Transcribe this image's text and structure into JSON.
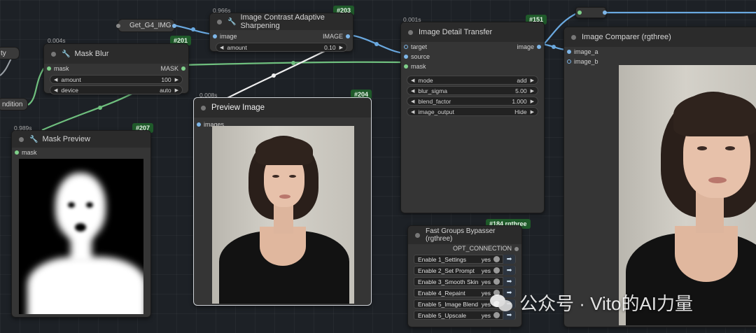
{
  "colors": {
    "badge_green": "#1f5a2a",
    "wire_blue": "#6aa9e0",
    "wire_green": "#6fbf7e",
    "wire_white": "#f0f0f0"
  },
  "left_fragments": {
    "top": "ty",
    "bottom": "ndition"
  },
  "get_node": {
    "label": "Get_G4_IMG"
  },
  "mask_blur": {
    "time": "0.004s",
    "badge": "#201",
    "title": "Mask Blur",
    "in_mask": "mask",
    "out_mask": "MASK",
    "amount_label": "amount",
    "amount_value": "100",
    "device_label": "device",
    "device_value": "auto"
  },
  "sharpen": {
    "time": "0.966s",
    "badge": "#203",
    "title": "Image Contrast Adaptive Sharpening",
    "in_image": "image",
    "out_image": "IMAGE",
    "amount_label": "amount",
    "amount_value": "0.10"
  },
  "detail": {
    "time": "0.001s",
    "badge": "#151",
    "title": "Image Detail Transfer",
    "in_target": "target",
    "in_source": "source",
    "in_mask": "mask",
    "out_image": "image",
    "widgets": [
      {
        "label": "mode",
        "value": "add"
      },
      {
        "label": "blur_sigma",
        "value": "5.00"
      },
      {
        "label": "blend_factor",
        "value": "1.000"
      },
      {
        "label": "image_output",
        "value": "Hide"
      }
    ]
  },
  "comparer": {
    "title": "Image Comparer (rgthree)",
    "in_a": "image_a",
    "in_b": "image_b"
  },
  "preview": {
    "time": "0.008s",
    "badge": "#204",
    "title": "Preview Image",
    "in_images": "images"
  },
  "mask_preview": {
    "time": "0.989s",
    "badge": "#207",
    "title": "Mask Preview",
    "in_mask": "mask"
  },
  "bypasser": {
    "badge": "#184 rgthree",
    "title": "Fast Groups Bypasser (rgthree)",
    "out": "OPT_CONNECTION",
    "items": [
      {
        "label": "Enable 1_Settings",
        "state": "yes"
      },
      {
        "label": "Enable 2_Set Prompt",
        "state": "yes"
      },
      {
        "label": "Enable 3_Smooth Skin",
        "state": "yes"
      },
      {
        "label": "Enable 4_Repaint",
        "state": "yes"
      },
      {
        "label": "Enable 5_Image Blend",
        "state": "yes"
      },
      {
        "label": "Enable 5_Upscale",
        "state": "yes"
      }
    ]
  },
  "watermark": {
    "text": "公众号 · Vito的AI力量"
  }
}
